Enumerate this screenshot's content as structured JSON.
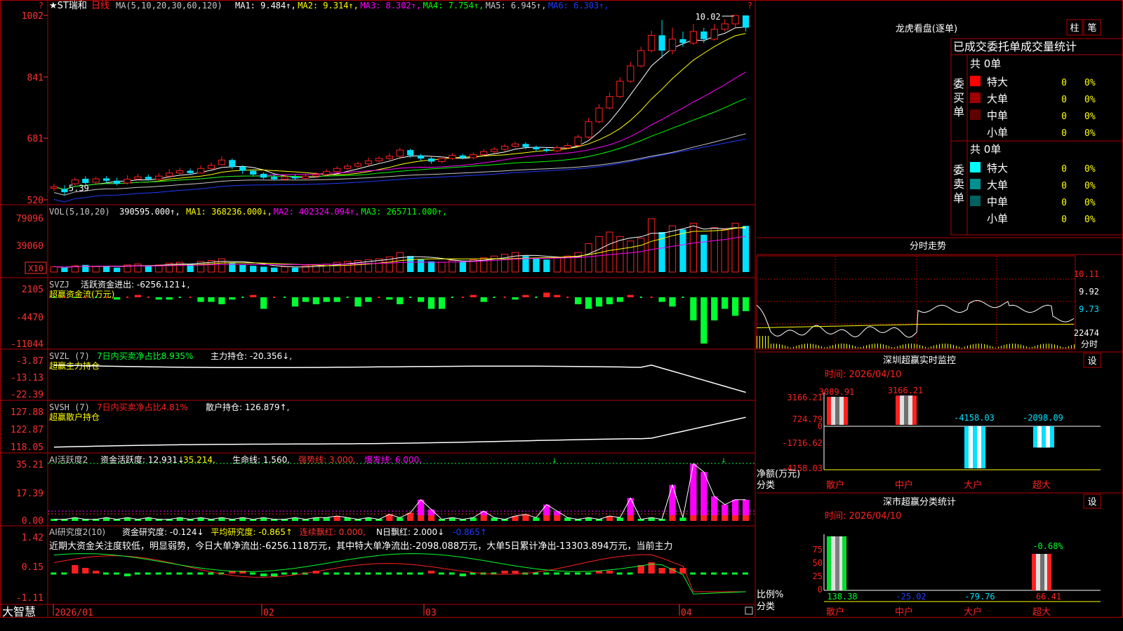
{
  "colors": {
    "up": "#ff2020",
    "down": "#00e0ff",
    "frame": "#b00000",
    "axis": "#ff3030",
    "white": "#ffffff",
    "yellow": "#ffff00",
    "magenta": "#ff00ff",
    "green": "#00ff00",
    "gray": "#c8c8c8",
    "blue": "#1e3cff",
    "lime": "#00ff30"
  },
  "header": {
    "stock": "★ST瑞和",
    "period": "日线",
    "ma_params": "MA(5,10,20,30,60,120)",
    "ma": [
      {
        "label": "MA1:",
        "value": "9.484",
        "arrow": "↑",
        "color": "#ffffff"
      },
      {
        "label": "MA2:",
        "value": "9.314",
        "arrow": "↑",
        "color": "#ffff00"
      },
      {
        "label": "MA3:",
        "value": "8.302",
        "arrow": "↑",
        "color": "#ff00ff"
      },
      {
        "label": "MA4:",
        "value": "7.754",
        "arrow": "↑",
        "color": "#00ff00"
      },
      {
        "label": "MA5:",
        "value": "6.945",
        "arrow": "↑",
        "color": "#c8c8c8"
      },
      {
        "label": "MA6:",
        "value": "6.303",
        "arrow": "↑",
        "color": "#1e3cff"
      }
    ],
    "q": "?"
  },
  "price_axis": [
    "1002",
    "841",
    "681",
    "520"
  ],
  "price_labels": {
    "high": "10.02",
    "low": "5.39"
  },
  "vol": {
    "title": "VOL(5,10,20)",
    "value": "390595.000",
    "ma": [
      {
        "label": "MA1:",
        "value": "368236.000",
        "arrow": "↓",
        "color": "#ffff00"
      },
      {
        "label": "MA2:",
        "value": "402324.094",
        "arrow": "↑",
        "color": "#ff00ff"
      },
      {
        "label": "MA3:",
        "value": "265711.000",
        "arrow": "↑",
        "color": "#00ff00"
      }
    ],
    "axis": [
      "79096",
      "39060"
    ],
    "unit": "X10"
  },
  "svzj": {
    "title": "SVZJ",
    "label": "活跃资金进出:",
    "value": "-6256.121",
    "arrow": "↓",
    "sub": "超赢资金流(万元)",
    "axis": [
      "2105",
      "-4470",
      "-11044"
    ]
  },
  "svzl": {
    "title": "SVZL (7)",
    "pct_label": "7日内买卖净占比8.935%",
    "label": "主力持仓:",
    "value": "-20.356",
    "arrow": "↓",
    "sub": "超赢主力持仓",
    "axis": [
      "-3.87",
      "-13.13",
      "-22.39"
    ]
  },
  "svsh": {
    "title": "SVSH (7)",
    "pct_label": "7日内买卖净占比4.81%",
    "label": "散户持仓:",
    "value": "126.879",
    "arrow": "↑",
    "sub": "超赢散户持仓",
    "axis": [
      "127.88",
      "122.87",
      "118.05"
    ]
  },
  "ai1": {
    "title": "AI活跃度2",
    "items": [
      {
        "label": "资金活跃度:",
        "value": "12.931",
        "arrow": "↓",
        "color": "#ffffff"
      },
      {
        "label": "",
        "value": "35.214",
        "arrow": ",",
        "color": "#ffff00"
      },
      {
        "label": "生命线:",
        "value": "1.560",
        "arrow": ",",
        "color": "#ffffff"
      },
      {
        "label": "强势线:",
        "value": "3.000",
        "arrow": ",",
        "color": "#ff3030"
      },
      {
        "label": "爆发线:",
        "value": "6.000",
        "arrow": ",",
        "color": "#ff00ff"
      }
    ],
    "axis": [
      "35.21",
      "17.39",
      "0.00"
    ]
  },
  "ai2": {
    "title": "AI研究度2(10)",
    "items": [
      {
        "label": "资金研究度:",
        "value": "-0.124",
        "arrow": "↓",
        "color": "#ffffff"
      },
      {
        "label": "平均研究度:",
        "value": "-0.865",
        "arrow": "↑",
        "color": "#ffff00"
      },
      {
        "label": "连续飘红:",
        "value": "0.000",
        "arrow": ",",
        "color": "#ff3030"
      },
      {
        "label": "N日飘红:",
        "value": "2.000",
        "arrow": "↓",
        "color": "#ffffff"
      },
      {
        "label": "",
        "value": "-0.865",
        "arrow": "↑",
        "color": "#1e3cff"
      }
    ],
    "text": "近期大资金关注度较低，明显弱势，今日大单净流出:-6256.118万元，其中特大单净流出:-2098.088万元，大单5日累计净出-13303.894万元，当前主力",
    "axis": [
      "1.42",
      "0.15",
      "-1.11"
    ]
  },
  "bottom": {
    "brand": "大智慧",
    "dates": [
      "2026/01",
      "02",
      "03",
      "04"
    ]
  },
  "right": {
    "lhb_title": "龙虎看盘(逐单)",
    "btn1": "柱",
    "btn2": "笔",
    "stats_title": "已成交委托单成交量统计",
    "buy_label": "委买单",
    "sell_label": "委卖单",
    "buy_total": "共 0单",
    "sell_total": "共 0单",
    "buy_rows": [
      {
        "name": "特大",
        "v": "0",
        "p": "0%",
        "c": "#ff0000"
      },
      {
        "name": "大单",
        "v": "0",
        "p": "0%",
        "c": "#a00000"
      },
      {
        "name": "中单",
        "v": "0",
        "p": "0%",
        "c": "#600000"
      },
      {
        "name": "小单",
        "v": "0",
        "p": "0%",
        "c": "#000000"
      }
    ],
    "sell_rows": [
      {
        "name": "特大",
        "v": "0",
        "p": "0%",
        "c": "#00ffff"
      },
      {
        "name": "大单",
        "v": "0",
        "p": "0%",
        "c": "#009090"
      },
      {
        "name": "中单",
        "v": "0",
        "p": "0%",
        "c": "#006060"
      },
      {
        "name": "小单",
        "v": "0",
        "p": "0%",
        "c": "#000000"
      }
    ],
    "fs_title": "分时走势",
    "fs_axis": [
      "10.11",
      "9.92",
      "9.73",
      "22474"
    ],
    "fs_unit": "分时",
    "mon_title": "深圳超赢实时监控",
    "mon_btn": "设",
    "mon_time": "时间: 2026/04/10",
    "mon_axis": [
      "3166.21",
      "724.79",
      "0",
      "-1716.62",
      "-4158.03"
    ],
    "mon_ylabel": "净额(万元)",
    "mon_xlabel": "分类",
    "mon_values": [
      "3089.91",
      "3166.21",
      "-4158.03",
      "-2098.09"
    ],
    "cats": [
      "散户",
      "中户",
      "大户",
      "超大"
    ],
    "cls_title": "深市超赢分类统计",
    "cls_btn": "设",
    "cls_time": "时间: 2026/04/10",
    "cls_axis": [
      "75",
      "50",
      "25",
      "0"
    ],
    "cls_pct": "-0.68%",
    "cls_ylabel": "比例%",
    "cls_xlabel": "分类",
    "cls_values": [
      "138.38",
      "-25.02",
      "-79.76",
      "66.41"
    ]
  },
  "chart_data": {
    "type": "candlestick",
    "dates_range": [
      "2026/01",
      "2026/04"
    ],
    "ylim": [
      5.2,
      10.02
    ],
    "candles": [
      [
        5.5,
        5.54,
        5.62,
        5.43
      ],
      [
        5.48,
        5.4,
        5.58,
        5.32
      ],
      [
        5.62,
        5.72,
        5.78,
        5.58
      ],
      [
        5.75,
        5.64,
        5.82,
        5.6
      ],
      [
        5.66,
        5.75,
        5.8,
        5.62
      ],
      [
        5.76,
        5.7,
        5.82,
        5.64
      ],
      [
        5.7,
        5.62,
        5.78,
        5.58
      ],
      [
        5.64,
        5.74,
        5.84,
        5.6
      ],
      [
        5.74,
        5.8,
        5.88,
        5.72
      ],
      [
        5.8,
        5.74,
        5.86,
        5.7
      ],
      [
        5.74,
        5.82,
        5.9,
        5.72
      ],
      [
        5.82,
        5.9,
        6.0,
        5.78
      ],
      [
        5.9,
        5.96,
        6.04,
        5.86
      ],
      [
        5.96,
        5.9,
        6.02,
        5.86
      ],
      [
        5.9,
        6.02,
        6.1,
        5.88
      ],
      [
        6.02,
        6.1,
        6.18,
        6.0
      ],
      [
        6.12,
        6.24,
        6.34,
        6.1
      ],
      [
        6.24,
        6.06,
        6.28,
        6.0
      ],
      [
        6.06,
        5.96,
        6.1,
        5.88
      ],
      [
        5.96,
        5.86,
        6.0,
        5.8
      ],
      [
        5.88,
        5.78,
        5.92,
        5.74
      ],
      [
        5.8,
        5.74,
        5.86,
        5.7
      ],
      [
        5.74,
        5.8,
        5.86,
        5.7
      ],
      [
        5.8,
        5.76,
        5.86,
        5.72
      ],
      [
        5.76,
        5.82,
        5.88,
        5.72
      ],
      [
        5.82,
        5.86,
        5.92,
        5.78
      ],
      [
        5.86,
        5.94,
        6.0,
        5.82
      ],
      [
        5.94,
        6.02,
        6.08,
        5.9
      ],
      [
        6.02,
        6.08,
        6.14,
        5.98
      ],
      [
        6.08,
        6.14,
        6.2,
        6.04
      ],
      [
        6.14,
        6.22,
        6.3,
        6.1
      ],
      [
        6.22,
        6.28,
        6.34,
        6.18
      ],
      [
        6.28,
        6.34,
        6.42,
        6.24
      ],
      [
        6.34,
        6.5,
        6.56,
        6.3
      ],
      [
        6.5,
        6.36,
        6.54,
        6.3
      ],
      [
        6.36,
        6.28,
        6.4,
        6.22
      ],
      [
        6.28,
        6.2,
        6.32,
        6.14
      ],
      [
        6.2,
        6.28,
        6.34,
        6.16
      ],
      [
        6.28,
        6.36,
        6.42,
        6.24
      ],
      [
        6.36,
        6.3,
        6.4,
        6.26
      ],
      [
        6.3,
        6.38,
        6.44,
        6.26
      ],
      [
        6.38,
        6.46,
        6.52,
        6.34
      ],
      [
        6.46,
        6.52,
        6.58,
        6.42
      ],
      [
        6.52,
        6.6,
        6.66,
        6.48
      ],
      [
        6.6,
        6.66,
        6.72,
        6.56
      ],
      [
        6.66,
        6.58,
        6.7,
        6.52
      ],
      [
        6.58,
        6.52,
        6.62,
        6.46
      ],
      [
        6.52,
        6.48,
        6.56,
        6.44
      ],
      [
        6.48,
        6.56,
        6.62,
        6.44
      ],
      [
        6.56,
        6.62,
        6.68,
        6.52
      ],
      [
        6.62,
        6.84,
        6.9,
        6.58
      ],
      [
        6.84,
        7.24,
        7.34,
        6.8
      ],
      [
        7.24,
        7.6,
        7.7,
        7.2
      ],
      [
        7.6,
        7.9,
        8.0,
        7.56
      ],
      [
        7.9,
        8.3,
        8.4,
        7.86
      ],
      [
        8.3,
        8.7,
        8.8,
        8.26
      ],
      [
        8.7,
        9.1,
        9.2,
        8.66
      ],
      [
        9.1,
        9.5,
        9.62,
        9.06
      ],
      [
        9.5,
        9.1,
        9.9,
        8.9
      ],
      [
        9.1,
        9.4,
        9.7,
        9.0
      ],
      [
        9.4,
        9.3,
        9.6,
        9.2
      ],
      [
        9.3,
        9.6,
        9.8,
        9.24
      ],
      [
        9.6,
        9.4,
        9.7,
        9.3
      ],
      [
        9.4,
        9.66,
        9.8,
        9.36
      ],
      [
        9.66,
        9.8,
        9.92,
        9.6
      ],
      [
        9.8,
        10.02,
        10.02,
        9.7
      ],
      [
        10.02,
        9.7,
        10.02,
        9.6
      ]
    ],
    "volume": [
      6,
      5,
      7,
      8,
      6,
      7,
      5,
      8,
      9,
      7,
      8,
      10,
      11,
      9,
      12,
      13,
      15,
      10,
      8,
      7,
      6,
      5,
      6,
      5,
      7,
      8,
      9,
      11,
      12,
      13,
      14,
      15,
      17,
      22,
      18,
      14,
      12,
      11,
      13,
      12,
      14,
      16,
      18,
      20,
      22,
      18,
      15,
      14,
      16,
      18,
      22,
      32,
      40,
      45,
      40,
      35,
      38,
      60,
      45,
      52,
      48,
      55,
      42,
      50,
      48,
      55,
      52
    ],
    "fs_price_range": [
      9.55,
      10.11
    ]
  }
}
